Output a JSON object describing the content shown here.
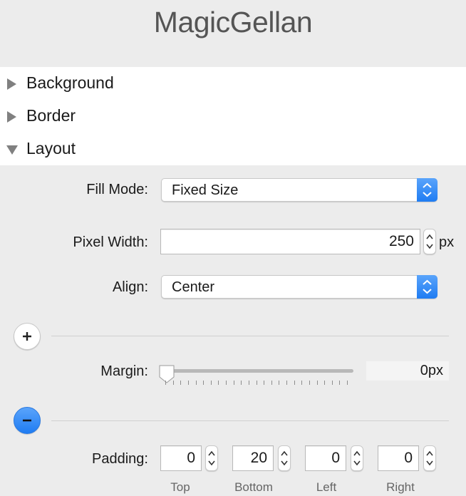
{
  "app": {
    "title": "MagicGellan"
  },
  "sections": [
    {
      "label": "Background",
      "expanded": false
    },
    {
      "label": "Border",
      "expanded": false
    },
    {
      "label": "Layout",
      "expanded": true
    }
  ],
  "layout": {
    "fill_mode": {
      "label": "Fill Mode:",
      "value": "Fixed Size"
    },
    "pixel_width": {
      "label": "Pixel Width:",
      "value": "250",
      "unit": "px"
    },
    "align": {
      "label": "Align:",
      "value": "Center"
    },
    "margin": {
      "label": "Margin:",
      "value": "0px",
      "slider_value": 0
    },
    "padding": {
      "label": "Padding:",
      "fields": [
        {
          "name": "Top",
          "value": "0"
        },
        {
          "name": "Bottom",
          "value": "20"
        },
        {
          "name": "Left",
          "value": "0"
        },
        {
          "name": "Right",
          "value": "0"
        }
      ]
    },
    "add_button": "+",
    "remove_button": "−"
  },
  "colors": {
    "accent": "#1f7cf2",
    "sections_bg": "#ffffff",
    "panel_bg": "#ececec"
  }
}
